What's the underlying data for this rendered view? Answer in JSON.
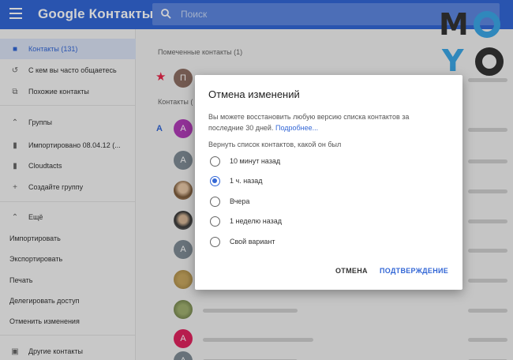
{
  "header": {
    "app_title": "Google Контакты",
    "search_placeholder": "Поиск",
    "logo_letters": [
      "M",
      "Y"
    ]
  },
  "sidebar": {
    "items": [
      {
        "label": "Контакты (131)",
        "icon": "contacts-icon"
      },
      {
        "label": "С кем вы часто общаетесь",
        "icon": "history-icon"
      },
      {
        "label": "Похожие контакты",
        "icon": "copy-icon"
      },
      {
        "label": "Группы",
        "icon": "chevron-up-icon"
      },
      {
        "label": "Импортировано 08.04.12 (...",
        "icon": "label-icon"
      },
      {
        "label": "Cloudtacts",
        "icon": "label-icon"
      },
      {
        "label": "Создайте группу",
        "icon": "plus-icon"
      },
      {
        "label": "Ещё",
        "icon": "chevron-up-icon"
      },
      {
        "label": "Импортировать"
      },
      {
        "label": "Экспортировать"
      },
      {
        "label": "Печать"
      },
      {
        "label": "Делегировать доступ"
      },
      {
        "label": "Отменить изменения"
      },
      {
        "label": "Другие контакты",
        "icon": "add-box-icon"
      }
    ]
  },
  "main": {
    "starred_label": "Помеченные контакты (1)",
    "contacts_label": "Контакты (",
    "starred_avatar_letter": "П",
    "section_letter": "A",
    "avatar_letter": "A"
  },
  "dialog": {
    "title": "Отмена изменений",
    "description": "Вы можете восстановить любую версию списка контактов за последние 30 дней.",
    "link": "Подробнее...",
    "subtitle": "Вернуть список контактов, какой он был",
    "options": [
      "10 минут назад",
      "1 ч. назад",
      "Вчера",
      "1 неделю назад",
      "Свой вариант"
    ],
    "selected_index": 1,
    "cancel_label": "ОТМЕНА",
    "confirm_label": "ПОДТВЕРЖДЕНИЕ"
  },
  "colors": {
    "topbar": "#3367d6",
    "accent": "#3367d6",
    "star": "#e8264a",
    "avatar_purple": "#b03cb8",
    "avatar_grey": "#7f8c95",
    "avatar_red": "#e0245e"
  }
}
